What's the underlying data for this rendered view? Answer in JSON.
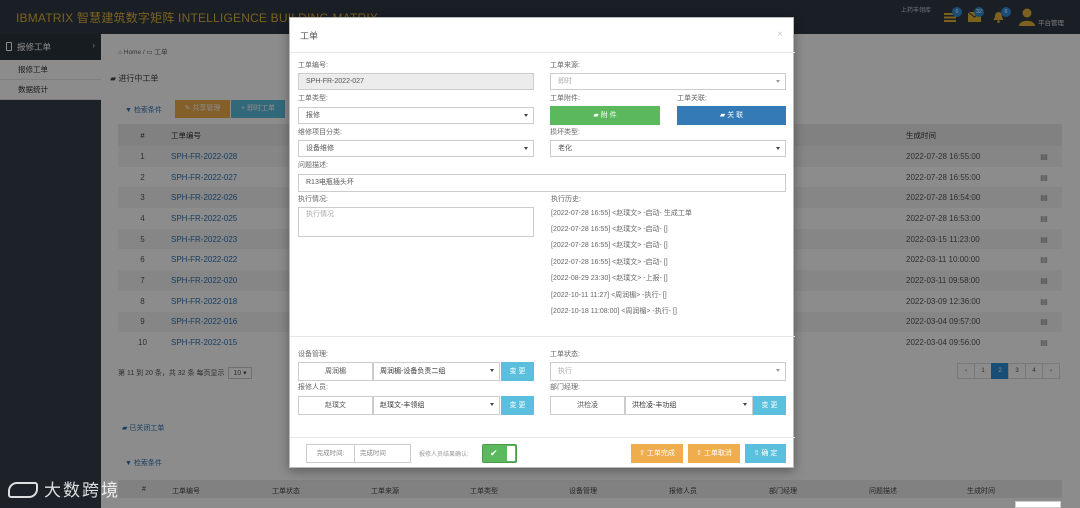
{
  "app": {
    "brand": "IBMATRIX 智慧建筑数字矩阵 INTELLIGENCE BUILDING MATRIX",
    "user": "上药丰翎库",
    "platform": "平台管理",
    "badges": [
      {
        "icon": "tasks-icon",
        "count": "6"
      },
      {
        "icon": "mail-icon",
        "count": "32"
      },
      {
        "icon": "bell-icon",
        "count": "6"
      }
    ]
  },
  "sidebar": {
    "section": "报修工单",
    "items": [
      "报修工单",
      "数据统计"
    ]
  },
  "breadcrumb": {
    "home": "Home",
    "sep": "/",
    "current": "工单"
  },
  "page": {
    "active_title": "进行中工单",
    "search_label": "检索条件",
    "share_label": "共享管理",
    "instant_label": "即时工单",
    "columns": {
      "num": "#",
      "code": "工单编号",
      "created": "生成时间"
    },
    "rows": [
      {
        "num": "1",
        "code": "SPH-FR-2022-028",
        "created": "2022-07-28 16:55:00"
      },
      {
        "num": "2",
        "code": "SPH-FR-2022-027",
        "created": "2022-07-28 16:55:00"
      },
      {
        "num": "3",
        "code": "SPH-FR-2022-026",
        "created": "2022-07-28 16:54:00"
      },
      {
        "num": "4",
        "code": "SPH-FR-2022-025",
        "created": "2022-07-28 16:53:00"
      },
      {
        "num": "5",
        "code": "SPH-FR-2022-023",
        "created": "2022-03-15 11:23:00"
      },
      {
        "num": "6",
        "code": "SPH-FR-2022-022",
        "created": "2022-03-11 10:00:00"
      },
      {
        "num": "7",
        "code": "SPH-FR-2022-020",
        "created": "2022-03-11 09:58:00"
      },
      {
        "num": "8",
        "code": "SPH-FR-2022-018",
        "created": "2022-03-09 12:36:00"
      },
      {
        "num": "9",
        "code": "SPH-FR-2022-016",
        "created": "2022-03-04 09:57:00"
      },
      {
        "num": "10",
        "code": "SPH-FR-2022-015",
        "created": "2022-03-04 09:56:00"
      }
    ],
    "page_info": "第 11 到 20 条，共 32 条 每页显示",
    "page_size": "10",
    "pages": [
      "‹",
      "1",
      "2",
      "3",
      "4",
      "›"
    ],
    "active_page": "2",
    "closed_title": "已关闭工单",
    "closed_search": "检索条件",
    "bottom_columns": [
      "#",
      "工单编号",
      "工单状态",
      "工单来源",
      "工单类型",
      "设备管理",
      "报修人员",
      "部门经理",
      "问题描述",
      "生成时间"
    ]
  },
  "modal": {
    "title": "工单",
    "close": "×",
    "ticket_no_label": "工单编号:",
    "ticket_no": "SPH-FR-2022-027",
    "source_label": "工单来源:",
    "source_value": "即时",
    "type_label": "工单类型:",
    "type_value": "报修",
    "attach_label": "工单附件:",
    "attach_button": "附 件",
    "link_label": "工单关联:",
    "link_button": "关 联",
    "category_label": "维修项目分类:",
    "category_value": "设备维修",
    "damage_label": "损坏类型:",
    "damage_value": "老化",
    "desc_label": "问题描述:",
    "desc_value": "R13电瓶插头坏",
    "exec_label": "执行情况:",
    "exec_placeholder": "执行情况",
    "history_label": "执行历史:",
    "history": [
      "[2022-07-28 16:55] <赵璞文> -启动- 生成工单",
      "[2022-07-28 16:55] <赵璞文> -启动- []",
      "[2022-07-28 16:55] <赵璞文> -启动- []",
      "[2022-07-28 16:55] <赵璞文> -启动- []",
      "[2022-08-29 23:30] <赵璞文> -上报- []",
      "[2022-10-11 11:27] <周润楣> -执行- []",
      "[2022-10-18 11:08:00] <周润楣> -执行- []"
    ],
    "equip_label": "设备管理:",
    "equip_name": "周润楣",
    "equip_select": "周润楣-设备负责二组",
    "reporter_label": "报修人员:",
    "reporter_name": "赵璞文",
    "reporter_select": "赵璞文-丰领组",
    "status_label": "工单状态:",
    "status_value": "执行",
    "manager_label": "部门经理:",
    "manager_name": "洪检凌",
    "manager_select": "洪检凌-丰功组",
    "change_label": "变 更",
    "finish_time_label": "完成时间:",
    "finish_time_placeholder": "完成时间",
    "confirm_text": "报修人员结果确认:",
    "complete_button": "工单完成",
    "cancel_button": "工单取消",
    "ok_button": "确 定"
  },
  "watermark": "大数跨境"
}
